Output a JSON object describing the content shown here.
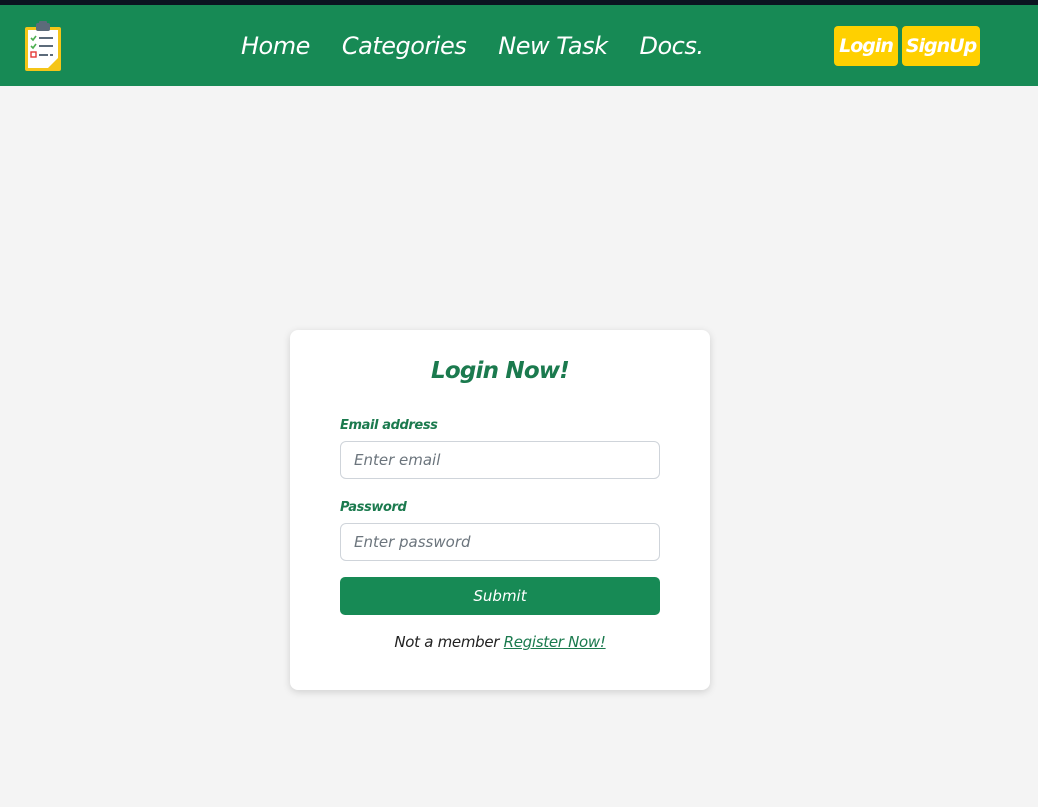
{
  "navbar": {
    "logo_icon": "clipboard-checklist-icon",
    "links": [
      {
        "label": "Home"
      },
      {
        "label": "Categories"
      },
      {
        "label": "New Task"
      },
      {
        "label": "Docs."
      }
    ],
    "login_label": "Login",
    "signup_label": "SignUp"
  },
  "login_form": {
    "title": "Login Now!",
    "email_label": "Email address",
    "email_placeholder": "Enter email",
    "password_label": "Password",
    "password_placeholder": "Enter password",
    "submit_label": "Submit",
    "register_prompt": "Not a member",
    "register_link": "Register Now!"
  },
  "colors": {
    "brand_green": "#178a55",
    "accent_yellow": "#ffd000",
    "background": "#f4f4f4"
  }
}
